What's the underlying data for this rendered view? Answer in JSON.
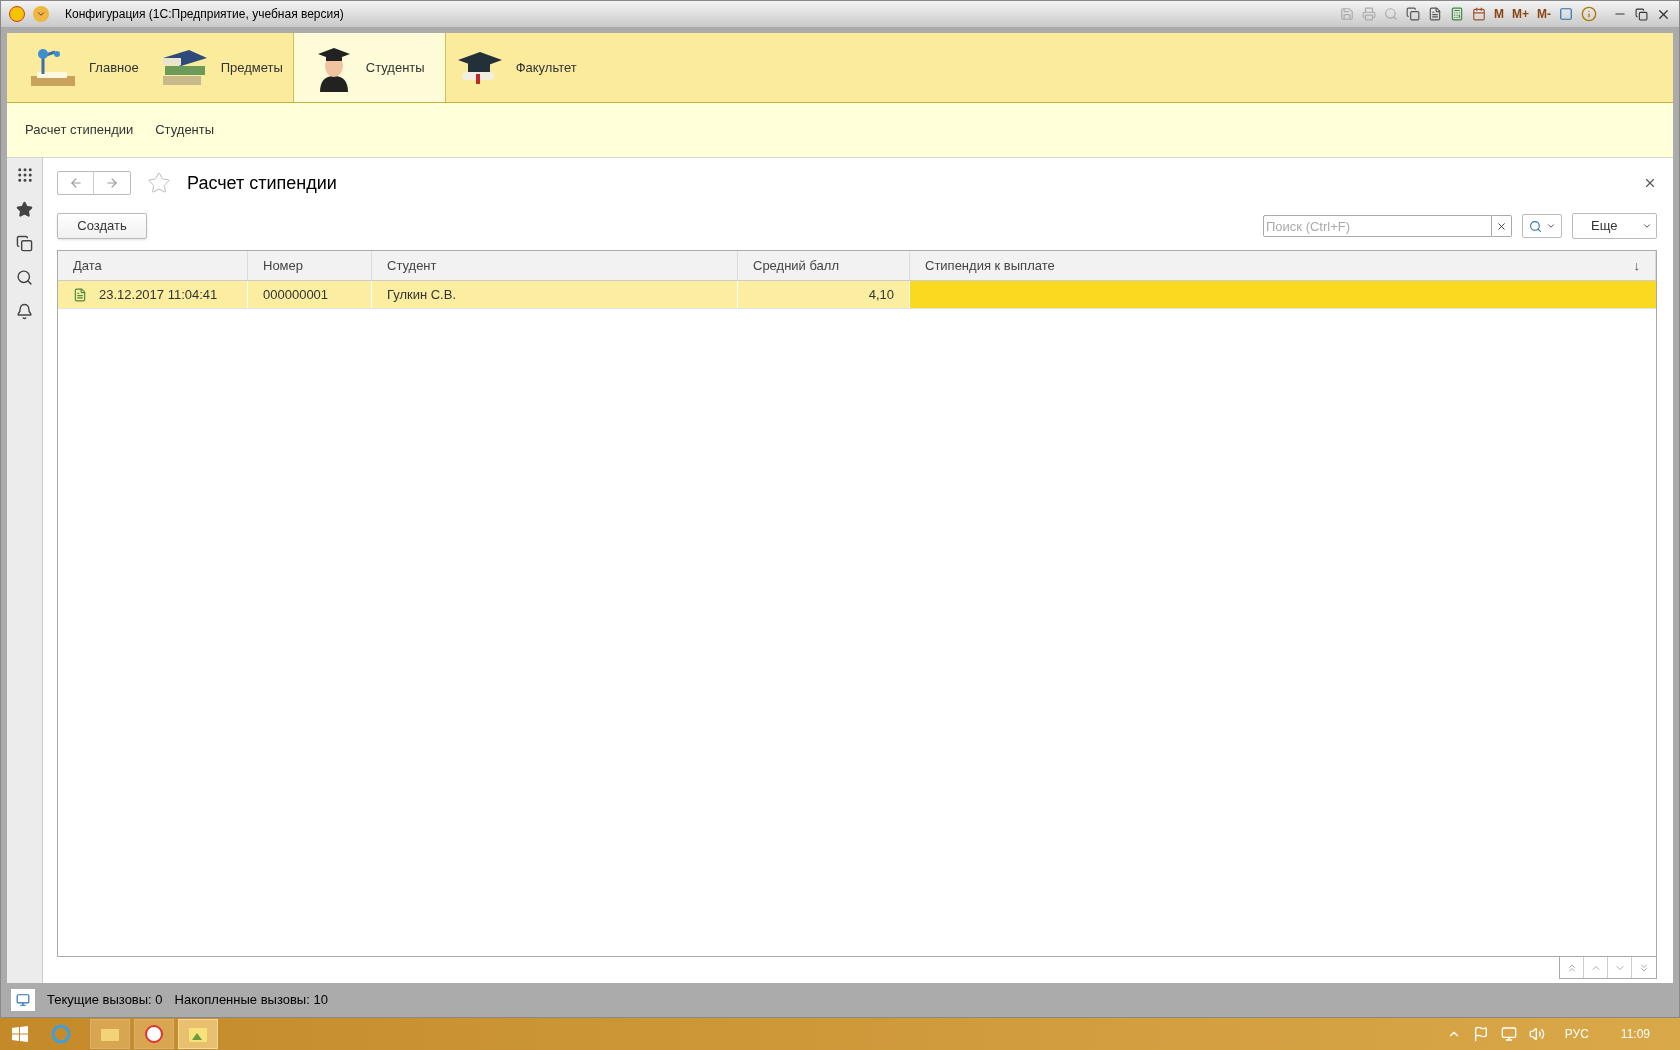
{
  "window": {
    "title": "Конфигурация  (1С:Предприятие, учебная версия)",
    "memory_buttons": [
      "M",
      "M+",
      "M-"
    ]
  },
  "sections": [
    {
      "label": "Главное",
      "kind": "lamp",
      "selected": false
    },
    {
      "label": "Предметы",
      "kind": "books",
      "selected": false
    },
    {
      "label": "Студенты",
      "kind": "student",
      "selected": true
    },
    {
      "label": "Факультет",
      "kind": "cap",
      "selected": false
    }
  ],
  "function_bar": {
    "items": [
      "Расчет стипендии",
      "Студенты"
    ]
  },
  "form": {
    "title": "Расчет стипендии",
    "create_button": "Создать",
    "search": {
      "placeholder": "Поиск (Ctrl+F)"
    },
    "more_button": "Еще"
  },
  "table": {
    "columns": [
      {
        "label": "Дата"
      },
      {
        "label": "Номер"
      },
      {
        "label": "Студент"
      },
      {
        "label": "Средний балл"
      },
      {
        "label": "Стипендия к выплате",
        "sort": "↓"
      }
    ],
    "rows": [
      {
        "date": "23.12.2017 11:04:41",
        "number": "000000001",
        "student": "Гулкин С.В.",
        "average": "4,10",
        "stipend": "",
        "selected": true
      }
    ]
  },
  "status_bar": {
    "current_calls": "Текущие вызовы: 0",
    "accumulated_calls": "Накопленные вызовы: 10"
  },
  "taskbar": {
    "language": "РУС",
    "time": "11:09"
  }
}
